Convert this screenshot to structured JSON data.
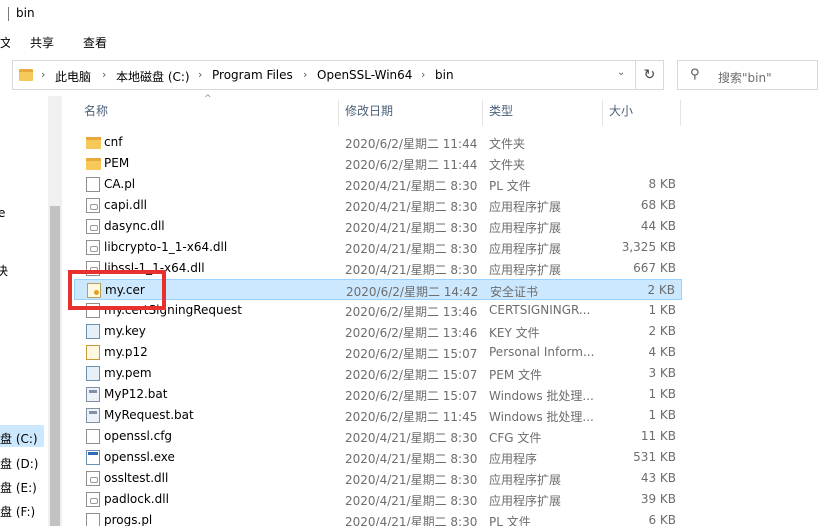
{
  "window": {
    "title": "bin"
  },
  "ribbon": {
    "left_fragment": "文",
    "tabs": [
      "共享",
      "查看"
    ]
  },
  "address": {
    "crumbs": [
      "此电脑",
      "本地磁盘 (C:)",
      "Program Files",
      "OpenSSL-Win64",
      "bin"
    ],
    "search_placeholder": "搜索\"bin\""
  },
  "nav": {
    "fragments": [
      "e",
      "决"
    ],
    "drives": [
      "盘 (C:)",
      "盘 (D:)",
      "盘 (E:)",
      "盘 (F:)"
    ]
  },
  "columns": {
    "name": "名称",
    "date": "修改日期",
    "type": "类型",
    "size": "大小"
  },
  "files": [
    {
      "name": "cnf",
      "date": "2020/6/2/星期二 11:44",
      "type": "文件夹",
      "size": "",
      "icon": "folder-icon"
    },
    {
      "name": "PEM",
      "date": "2020/6/2/星期二 11:44",
      "type": "文件夹",
      "size": "",
      "icon": "folder-icon"
    },
    {
      "name": "CA.pl",
      "date": "2020/4/21/星期二 8:30",
      "type": "PL 文件",
      "size": "8 KB",
      "icon": "file-icon"
    },
    {
      "name": "capi.dll",
      "date": "2020/4/21/星期二 8:30",
      "type": "应用程序扩展",
      "size": "68 KB",
      "icon": "dll-icon"
    },
    {
      "name": "dasync.dll",
      "date": "2020/4/21/星期二 8:30",
      "type": "应用程序扩展",
      "size": "44 KB",
      "icon": "dll-icon"
    },
    {
      "name": "libcrypto-1_1-x64.dll",
      "date": "2020/4/21/星期二 8:30",
      "type": "应用程序扩展",
      "size": "3,325 KB",
      "icon": "dll-icon"
    },
    {
      "name": "libssl-1_1-x64.dll",
      "date": "2020/4/21/星期二 8:30",
      "type": "应用程序扩展",
      "size": "667 KB",
      "icon": "dll-icon"
    },
    {
      "name": "my.cer",
      "date": "2020/6/2/星期二 14:42",
      "type": "安全证书",
      "size": "2 KB",
      "icon": "certificate-icon",
      "selected": true
    },
    {
      "name": "my.certSigningRequest",
      "date": "2020/6/2/星期二 13:46",
      "type": "CERTSIGNINGR...",
      "size": "1 KB",
      "icon": "file-icon"
    },
    {
      "name": "my.key",
      "date": "2020/6/2/星期二 13:46",
      "type": "KEY 文件",
      "size": "2 KB",
      "icon": "key-file-icon"
    },
    {
      "name": "my.p12",
      "date": "2020/6/2/星期二 15:07",
      "type": "Personal Inform...",
      "size": "4 KB",
      "icon": "p12-icon"
    },
    {
      "name": "my.pem",
      "date": "2020/6/2/星期二 15:07",
      "type": "PEM 文件",
      "size": "3 KB",
      "icon": "key-file-icon"
    },
    {
      "name": "MyP12.bat",
      "date": "2020/6/2/星期二 15:07",
      "type": "Windows 批处理...",
      "size": "1 KB",
      "icon": "batch-icon"
    },
    {
      "name": "MyRequest.bat",
      "date": "2020/6/2/星期二 11:45",
      "type": "Windows 批处理...",
      "size": "1 KB",
      "icon": "batch-icon"
    },
    {
      "name": "openssl.cfg",
      "date": "2020/4/21/星期二 8:30",
      "type": "CFG 文件",
      "size": "11 KB",
      "icon": "file-icon"
    },
    {
      "name": "openssl.exe",
      "date": "2020/4/21/星期二 8:30",
      "type": "应用程序",
      "size": "531 KB",
      "icon": "exe-icon"
    },
    {
      "name": "ossltest.dll",
      "date": "2020/4/21/星期二 8:30",
      "type": "应用程序扩展",
      "size": "43 KB",
      "icon": "dll-icon"
    },
    {
      "name": "padlock.dll",
      "date": "2020/4/21/星期二 8:30",
      "type": "应用程序扩展",
      "size": "39 KB",
      "icon": "dll-icon"
    },
    {
      "name": "progs.pl",
      "date": "2020/4/21/星期二 8:30",
      "type": "PL 文件",
      "size": "6 KB",
      "icon": "file-icon"
    }
  ],
  "colors": {
    "selection": "#cce8ff",
    "selection_border": "#99d1ff",
    "highlight": "#e8312f",
    "folder": "#f7c85a"
  }
}
